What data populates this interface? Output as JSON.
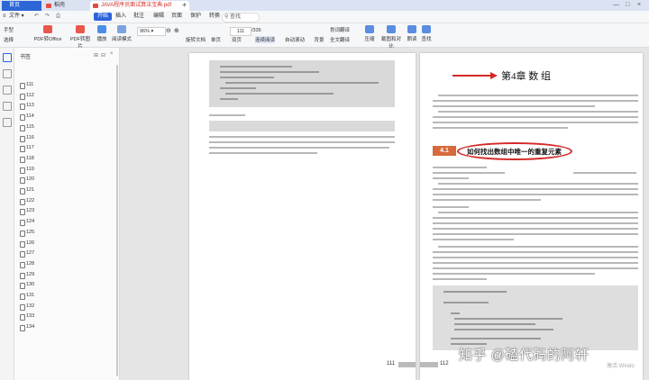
{
  "tabs": [
    {
      "label": "首页",
      "active": false
    },
    {
      "label": "稻壳",
      "active": false
    },
    {
      "label": "JAVA程序员面试算法宝典.pdf",
      "active": true
    }
  ],
  "menu": {
    "file": "文件",
    "items": [
      "开始",
      "插入",
      "批注",
      "编辑",
      "页面",
      "保护",
      "转换"
    ],
    "active": "开始",
    "search": "查找"
  },
  "toolbar": {
    "tools": [
      "手型",
      "选择",
      "PDF转Office",
      "PDF转图片",
      "播放",
      "阅读模式",
      "旋转文档",
      "单页",
      "双页",
      "连续阅读",
      "自动滚动",
      "背景",
      "划词翻译",
      "全文翻译",
      "压缩",
      "截图和对比",
      "朗读",
      "查找"
    ],
    "zoom": "96%",
    "page": "111",
    "page_total": "/335"
  },
  "bookmarks": {
    "title": "书签",
    "items": [
      "111",
      "112",
      "113",
      "114",
      "115",
      "116",
      "117",
      "118",
      "119",
      "120",
      "121",
      "122",
      "123",
      "124",
      "125",
      "126",
      "127",
      "128",
      "129",
      "130",
      "131",
      "132",
      "133",
      "134"
    ]
  },
  "document": {
    "left_page_number": "111",
    "right_page_number": "112",
    "chapter_title": "第4章  数    组",
    "section_number": "4.1",
    "section_title": "如何找出数组中唯一的重复元素"
  },
  "watermark": {
    "text": "知乎 @磕代码的阿轩",
    "system": "激活 Windo"
  }
}
